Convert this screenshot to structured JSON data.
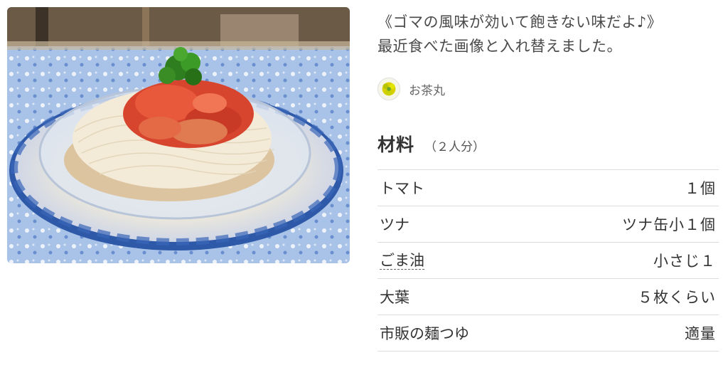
{
  "recipe": {
    "description_line1": "《ゴマの風味が効いて飽きない味だよ♪》",
    "description_line2": "最近食べた画像と入れ替えました。",
    "author": {
      "name": "お茶丸"
    }
  },
  "ingredients": {
    "title": "材料",
    "servings": "（２人分）",
    "items": [
      {
        "name": "トマト",
        "amount": "１個",
        "linked": false
      },
      {
        "name": "ツナ",
        "amount": "ツナ缶小１個",
        "linked": false
      },
      {
        "name": "ごま油",
        "amount": "小さじ１",
        "linked": true
      },
      {
        "name": "大葉",
        "amount": "５枚くらい",
        "linked": false
      },
      {
        "name": "市販の麺つゆ",
        "amount": "適量",
        "linked": false
      }
    ]
  }
}
